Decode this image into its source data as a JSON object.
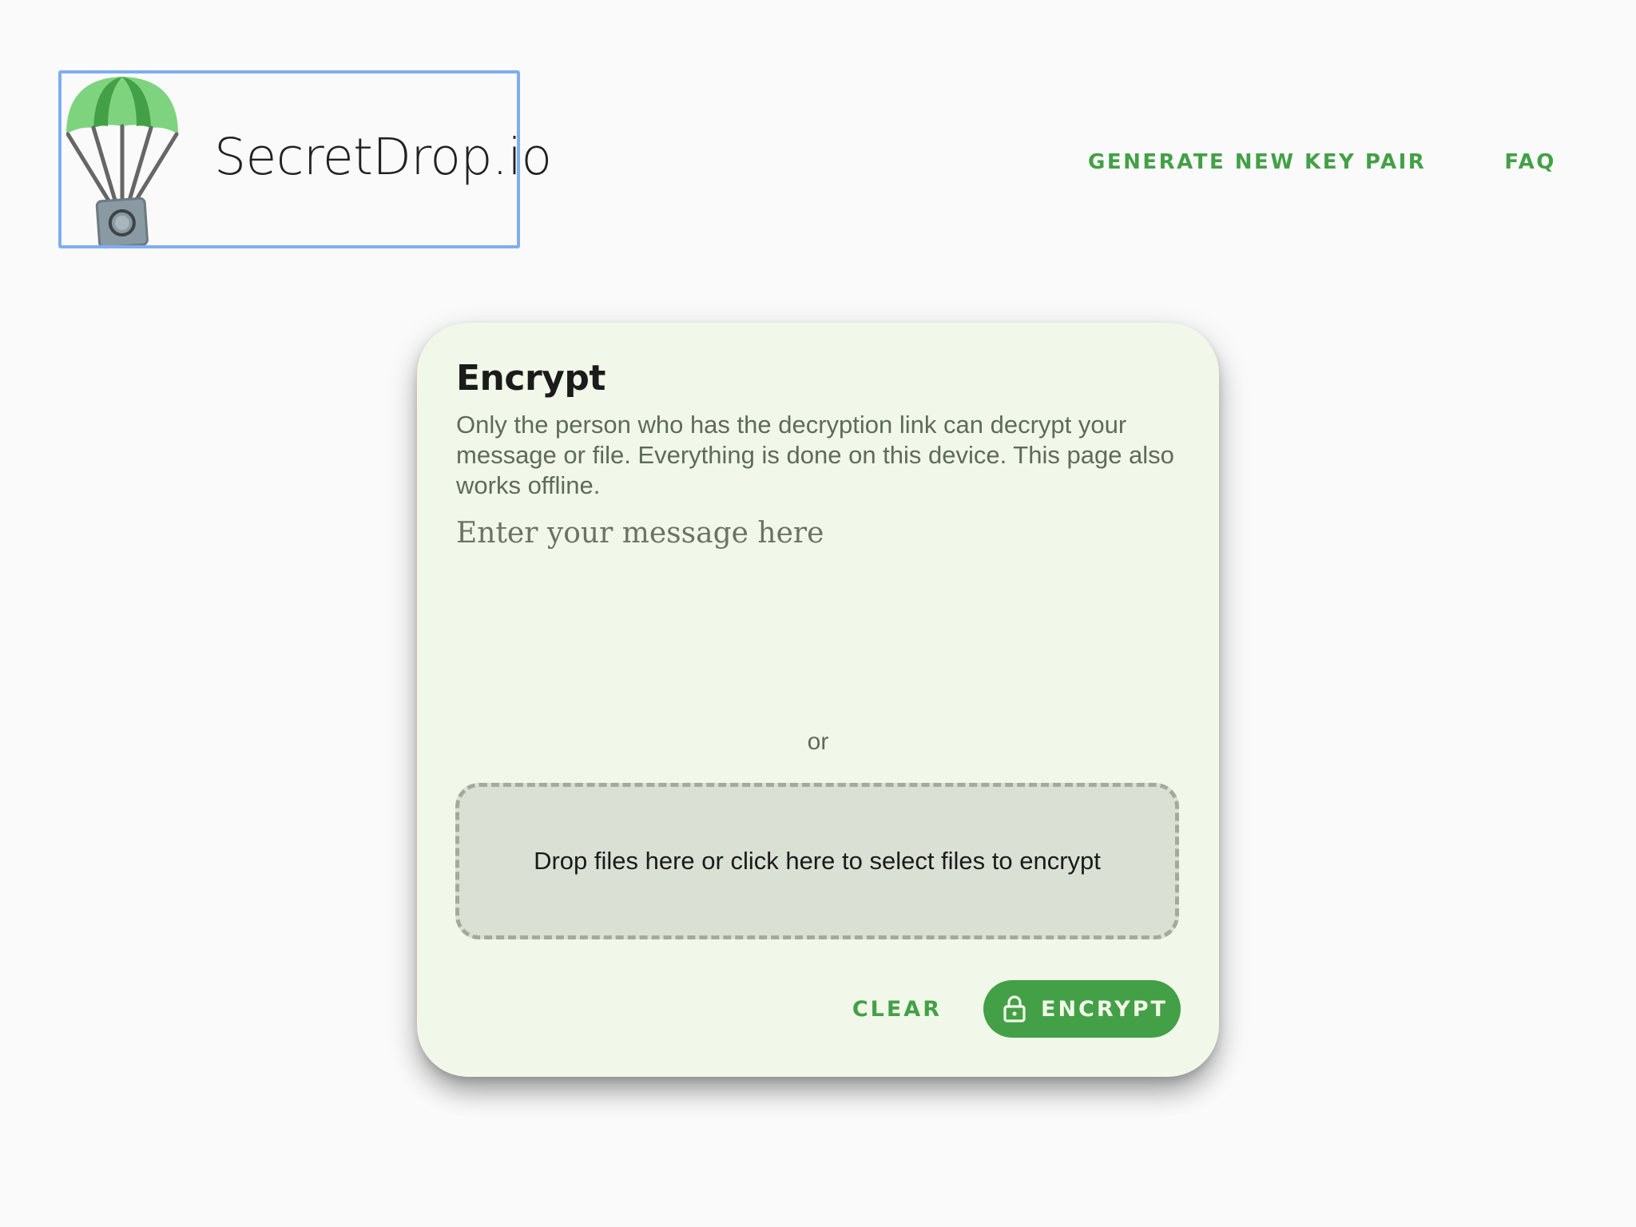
{
  "header": {
    "logo_text": "SecretDrop.io",
    "nav": {
      "generate_key_pair": "GENERATE NEW KEY PAIR",
      "faq": "FAQ"
    }
  },
  "card": {
    "title": "Encrypt",
    "description": "Only the person who has the decryption link can decrypt your message or file. Everything is done on this device. This page also works offline.",
    "message_input": {
      "placeholder": "Enter your message here",
      "value": ""
    },
    "or_text": "or",
    "dropzone_text": "Drop files here or click here to select files to encrypt",
    "clear_label": "CLEAR",
    "encrypt_label": "ENCRYPT"
  },
  "icons": {
    "logo": "parachute-safe-icon",
    "encrypt": "lock-icon"
  },
  "colors": {
    "accent": "#43a047",
    "card_background": "#f1f8e9",
    "page_background": "#fafafa",
    "dropzone_background": "#dae0d4",
    "focus_outline": "#7eaef0"
  }
}
